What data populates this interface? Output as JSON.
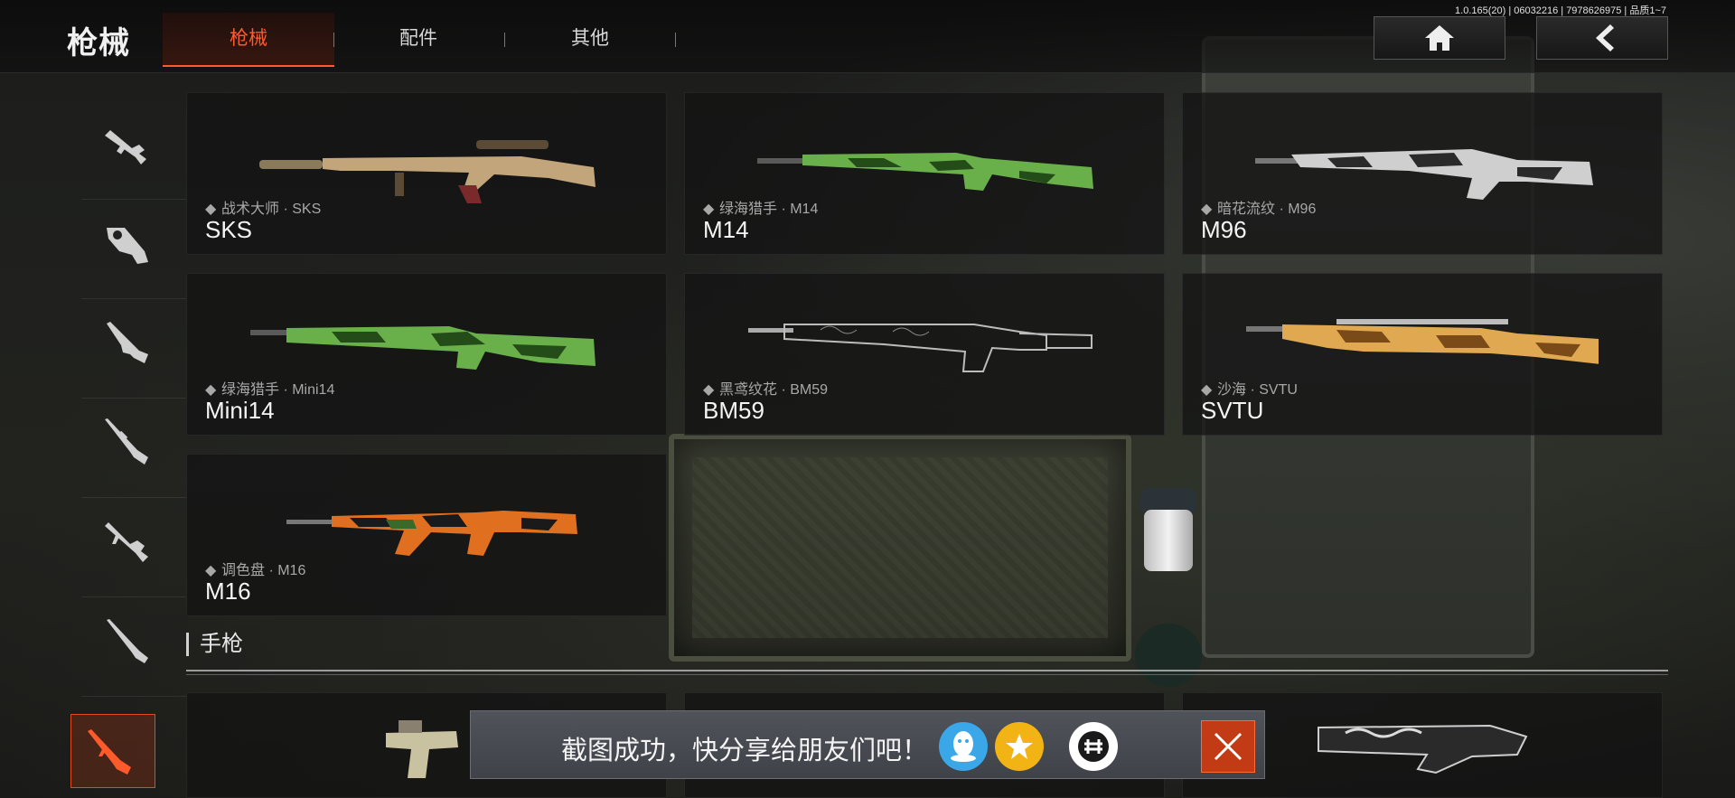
{
  "header": {
    "page_title": "枪械",
    "tabs": [
      {
        "label": "枪械",
        "active": true
      },
      {
        "label": "配件",
        "active": false
      },
      {
        "label": "其他",
        "active": false
      }
    ],
    "version_text": "1.0.165(20) | 06032216 | 7978626975 | 品质1~7",
    "home_icon": "home-icon",
    "back_icon": "back-arrow-icon"
  },
  "sidebar": {
    "items": [
      {
        "icon": "assault-rifle-icon",
        "active": false
      },
      {
        "icon": "smg-icon",
        "active": false
      },
      {
        "icon": "shotgun-icon",
        "active": false
      },
      {
        "icon": "sniper-rifle-icon",
        "active": false
      },
      {
        "icon": "light-machine-gun-icon",
        "active": false
      },
      {
        "icon": "marksman-rifle-icon",
        "active": false
      },
      {
        "icon": "rifle-icon",
        "active": true
      }
    ],
    "active_color": "#ff5a2b"
  },
  "weapons": [
    {
      "subtitle": "战术大师 · SKS",
      "name": "SKS",
      "skin": [
        "#8a7a5a",
        "#c2a57a",
        "#5a4a36"
      ]
    },
    {
      "subtitle": "绿海猎手 · M14",
      "name": "M14",
      "skin": [
        "#3f7a2a",
        "#6ab04a",
        "#234c18"
      ]
    },
    {
      "subtitle": "暗花流纹 · M96",
      "name": "M96",
      "skin": [
        "#2a2a2a",
        "#cfcfcf",
        "#555555"
      ]
    },
    {
      "subtitle": "绿海猎手 · Mini14",
      "name": "Mini14",
      "skin": [
        "#3f7a2a",
        "#6ab04a",
        "#234c18"
      ]
    },
    {
      "subtitle": "黑鸢纹花 · BM59",
      "name": "BM59",
      "skin": [
        "#1f1f1f",
        "#9a9a9a",
        "#444444"
      ]
    },
    {
      "subtitle": "沙海 · SVTU",
      "name": "SVTU",
      "skin": [
        "#b9782a",
        "#e0a850",
        "#7a4a18"
      ]
    },
    {
      "subtitle": "调色盘 · M16",
      "name": "M16",
      "skin": [
        "#1a1a1a",
        "#e07020",
        "#3a6a2a"
      ]
    }
  ],
  "section": {
    "title": "手枪"
  },
  "toast": {
    "message": "截图成功，快分享给朋友们吧！",
    "share_icons": [
      "qq-icon",
      "qzone-star-icon",
      "wechat-moments-icon"
    ],
    "close_icon": "close-icon",
    "accent": "#c23b14"
  }
}
